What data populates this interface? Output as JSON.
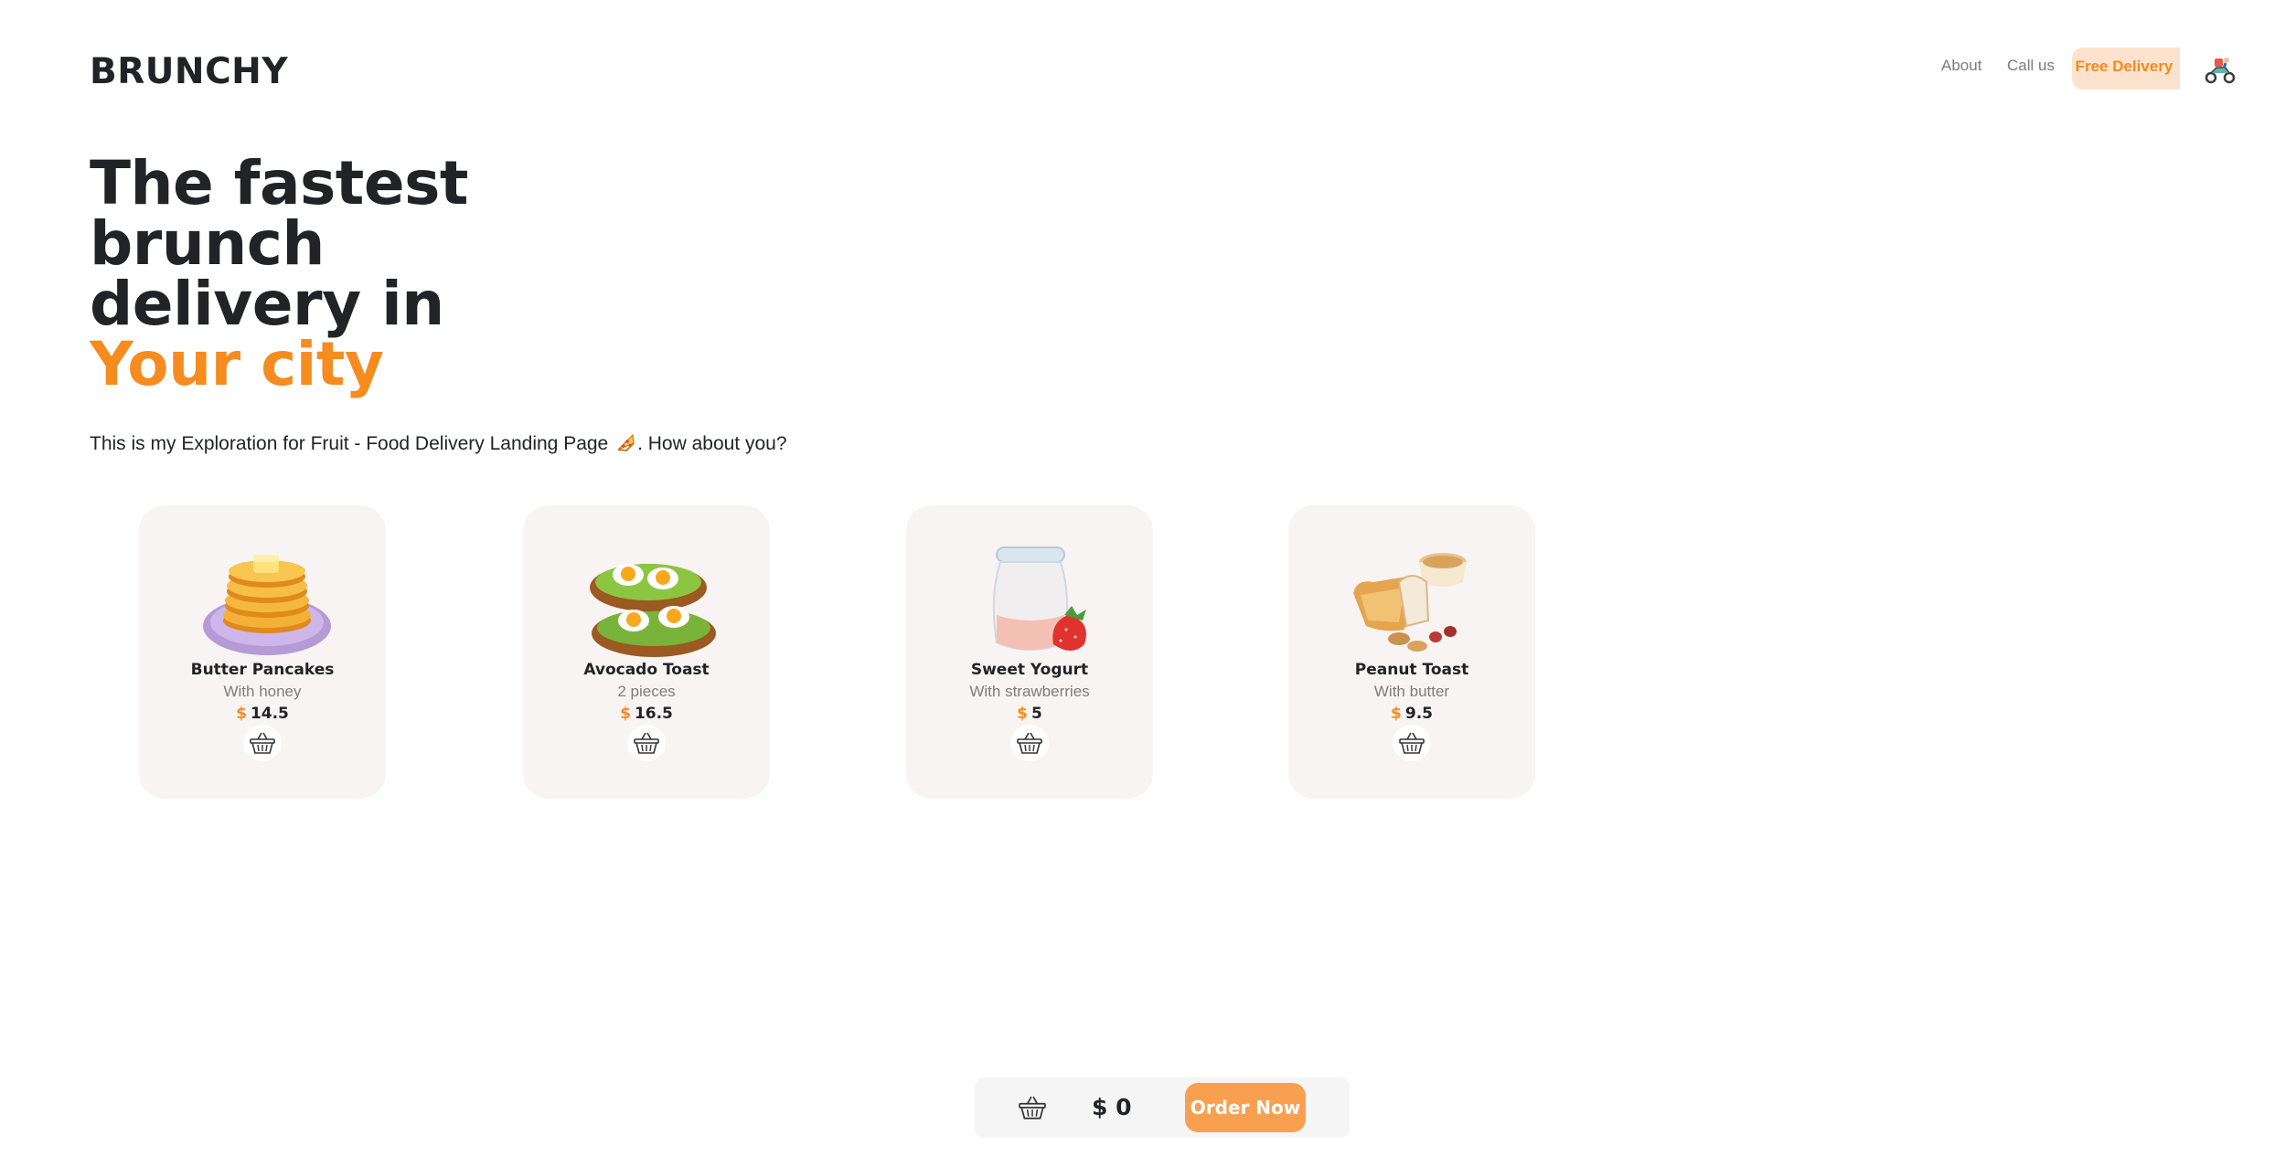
{
  "brand": {
    "logo": "BRUNCHY"
  },
  "nav": {
    "about": "About",
    "call_us": "Call us",
    "free_delivery": "Free Delivery",
    "scooter_icon": "scooter-icon"
  },
  "hero": {
    "line1": "The fastest",
    "line2": "brunch",
    "line3": "delivery in",
    "accent": "Your city",
    "subtitle_before": "This is my Exploration for Fruit - Food Delivery Landing Page ",
    "subtitle_after": ". How about you?"
  },
  "currency": "$",
  "products": [
    {
      "name": "Butter Pancakes",
      "desc": "With honey",
      "price": "14.5",
      "icon": "pancakes-icon"
    },
    {
      "name": "Avocado Toast",
      "desc": "2 pieces",
      "price": "16.5",
      "icon": "avocado-toast-icon"
    },
    {
      "name": "Sweet Yogurt",
      "desc": "With strawberries",
      "price": "5",
      "icon": "yogurt-icon"
    },
    {
      "name": "Peanut Toast",
      "desc": "With butter",
      "price": "9.5",
      "icon": "peanut-toast-icon"
    }
  ],
  "cart": {
    "total": "$ 0",
    "order_button": "Order Now"
  },
  "colors": {
    "accent": "#f68b1f",
    "card_bg": "#f8f4f3",
    "pill_bg": "#fde3cd",
    "order_button_bg": "#f9a050",
    "text": "#222327"
  }
}
